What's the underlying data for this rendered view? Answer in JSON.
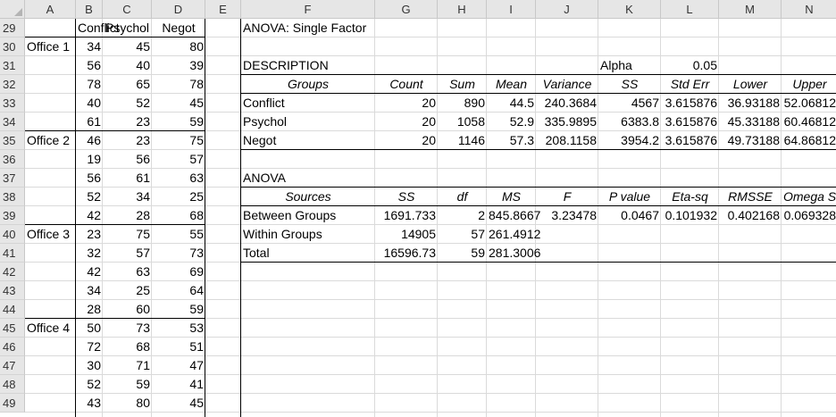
{
  "spreadsheet": {
    "columns": [
      "A",
      "B",
      "C",
      "D",
      "E",
      "F",
      "G",
      "H",
      "I",
      "J",
      "K",
      "L",
      "M",
      "N"
    ],
    "rows": [
      "29",
      "30",
      "31",
      "32",
      "33",
      "34",
      "35",
      "36",
      "37",
      "38",
      "39",
      "40",
      "41",
      "42",
      "43",
      "44",
      "45",
      "46",
      "47",
      "48",
      "49"
    ],
    "data_table": {
      "headers": [
        "Conflict",
        "Psychol",
        "Negot"
      ],
      "offices": [
        "Office 1",
        "Office 2",
        "Office 3",
        "Office 4"
      ],
      "values": [
        [
          34,
          45,
          80
        ],
        [
          56,
          40,
          39
        ],
        [
          78,
          65,
          78
        ],
        [
          40,
          52,
          45
        ],
        [
          61,
          23,
          59
        ],
        [
          46,
          23,
          75
        ],
        [
          19,
          56,
          57
        ],
        [
          56,
          61,
          63
        ],
        [
          52,
          34,
          25
        ],
        [
          42,
          28,
          68
        ],
        [
          23,
          75,
          55
        ],
        [
          32,
          57,
          73
        ],
        [
          42,
          63,
          69
        ],
        [
          34,
          25,
          64
        ],
        [
          28,
          60,
          59
        ],
        [
          50,
          73,
          53
        ],
        [
          72,
          68,
          51
        ],
        [
          30,
          71,
          47
        ],
        [
          52,
          59,
          41
        ],
        [
          43,
          80,
          45
        ]
      ]
    },
    "anova_title": "ANOVA: Single Factor",
    "description": {
      "title": "DESCRIPTION",
      "alpha_label": "Alpha",
      "alpha_value": "0.05",
      "headers": [
        "Groups",
        "Count",
        "Sum",
        "Mean",
        "Variance",
        "SS",
        "Std Err",
        "Lower",
        "Upper"
      ],
      "rows": [
        [
          "Conflict",
          "20",
          "890",
          "44.5",
          "240.3684",
          "4567",
          "3.615876",
          "36.93188",
          "52.06812"
        ],
        [
          "Psychol",
          "20",
          "1058",
          "52.9",
          "335.9895",
          "6383.8",
          "3.615876",
          "45.33188",
          "60.46812"
        ],
        [
          "Negot",
          "20",
          "1146",
          "57.3",
          "208.1158",
          "3954.2",
          "3.615876",
          "49.73188",
          "64.86812"
        ]
      ]
    },
    "anova": {
      "title": "ANOVA",
      "headers": [
        "Sources",
        "SS",
        "df",
        "MS",
        "F",
        "P value",
        "Eta-sq",
        "RMSSE",
        "Omega Sq"
      ],
      "rows": [
        [
          "Between Groups",
          "1691.733",
          "2",
          "845.8667",
          "3.23478",
          "0.0467",
          "0.101932",
          "0.402168",
          "0.069328"
        ],
        [
          "Within Groups",
          "14905",
          "57",
          "261.4912",
          "",
          "",
          "",
          "",
          ""
        ],
        [
          "Total",
          "16596.73",
          "59",
          "281.3006",
          "",
          "",
          "",
          "",
          ""
        ]
      ]
    }
  }
}
